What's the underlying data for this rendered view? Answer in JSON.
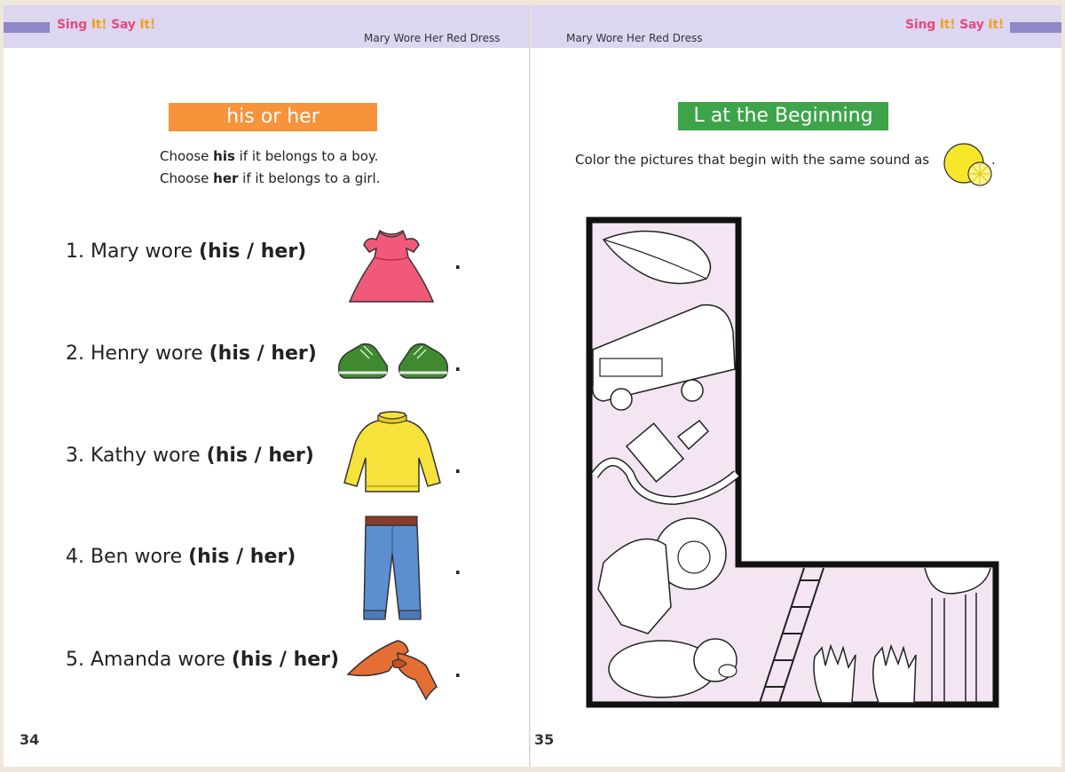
{
  "brand": {
    "part1": "Sing ",
    "part2": "It!",
    "part3": " Say ",
    "part4": "It!"
  },
  "song_title": "Mary Wore Her Red Dress",
  "left_page": {
    "heading": "his or her",
    "instruction_line1_pre": "Choose ",
    "instruction_line1_bold": "his",
    "instruction_line1_post": " if it belongs to a boy.",
    "instruction_line2_pre": "Choose ",
    "instruction_line2_bold": "her",
    "instruction_line2_post": " if it belongs to a girl.",
    "items": [
      {
        "text": "1. Mary wore ",
        "choice": "(his / her)",
        "picture": "red-dress"
      },
      {
        "text": "2. Henry wore ",
        "choice": "(his / her)",
        "picture": "green-shoes"
      },
      {
        "text": "3. Kathy wore ",
        "choice": "(his / her)",
        "picture": "yellow-sweater"
      },
      {
        "text": "4. Ben wore ",
        "choice": "(his / her)",
        "picture": "blue-jeans"
      },
      {
        "text": "5. Amanda wore ",
        "choice": "(his / her)",
        "picture": "orange-scarf"
      }
    ],
    "period": ".",
    "page_number": "34"
  },
  "right_page": {
    "heading": "L at the Beginning",
    "instruction": "Color the pictures that begin with the same sound as",
    "instruction_end": ".",
    "page_number": "35"
  },
  "colors": {
    "band": "#dcd6f0",
    "band_bar": "#8f88c6",
    "orange_heading": "#f7933a",
    "green_heading": "#3da44a",
    "l_fill": "#f3e6f2"
  }
}
